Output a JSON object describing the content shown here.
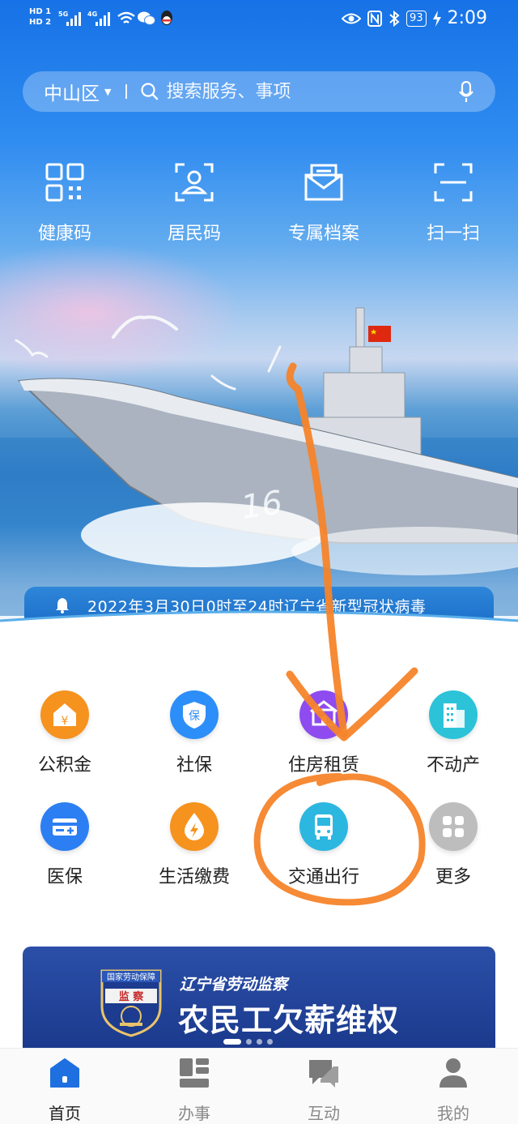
{
  "status_bar": {
    "sim1": "HD 1",
    "sim2": "HD 2",
    "net1": "5G",
    "net2": "4G",
    "battery": "93",
    "time": "2:09"
  },
  "search": {
    "district": "中山区",
    "placeholder": "搜索服务、事项"
  },
  "quick_actions": [
    {
      "label": "健康码",
      "icon": "qr-code-icon"
    },
    {
      "label": "居民码",
      "icon": "resident-code-icon"
    },
    {
      "label": "专属档案",
      "icon": "archive-tray-icon"
    },
    {
      "label": "扫一扫",
      "icon": "scan-icon"
    }
  ],
  "notice": {
    "text": "2022年3月30日0时至24时辽宁省新型冠状病毒"
  },
  "services": [
    {
      "label": "公积金",
      "icon": "housing-fund-icon",
      "color": "#f6921e"
    },
    {
      "label": "社保",
      "icon": "social-security-icon",
      "color": "#2c8ef8"
    },
    {
      "label": "住房租赁",
      "icon": "housing-rental-icon",
      "color": "#8e4bf0"
    },
    {
      "label": "不动产",
      "icon": "real-estate-icon",
      "color": "#2cc3d9"
    },
    {
      "label": "医保",
      "icon": "medical-insurance-icon",
      "color": "#2c7ff2"
    },
    {
      "label": "生活缴费",
      "icon": "utility-payment-icon",
      "color": "#f6921e"
    },
    {
      "label": "交通出行",
      "icon": "transit-bus-icon",
      "color": "#2cb7e0"
    },
    {
      "label": "更多",
      "icon": "more-grid-icon",
      "color": "#bdbdbd"
    }
  ],
  "banner": {
    "badge_text_top": "国家劳动保障",
    "badge_text_bottom": "监  察",
    "subtitle": "辽宁省劳动监察",
    "title": "农民工欠薪维权"
  },
  "bottom_nav": [
    {
      "label": "首页",
      "icon": "home-icon",
      "active": true
    },
    {
      "label": "办事",
      "icon": "services-icon",
      "active": false
    },
    {
      "label": "互动",
      "icon": "chat-icon",
      "active": false
    },
    {
      "label": "我的",
      "icon": "profile-icon",
      "active": false
    }
  ],
  "colors": {
    "brand_blue": "#1672e6",
    "annotation_orange": "#f5842a",
    "banner_blue": "#1b3a8d"
  }
}
